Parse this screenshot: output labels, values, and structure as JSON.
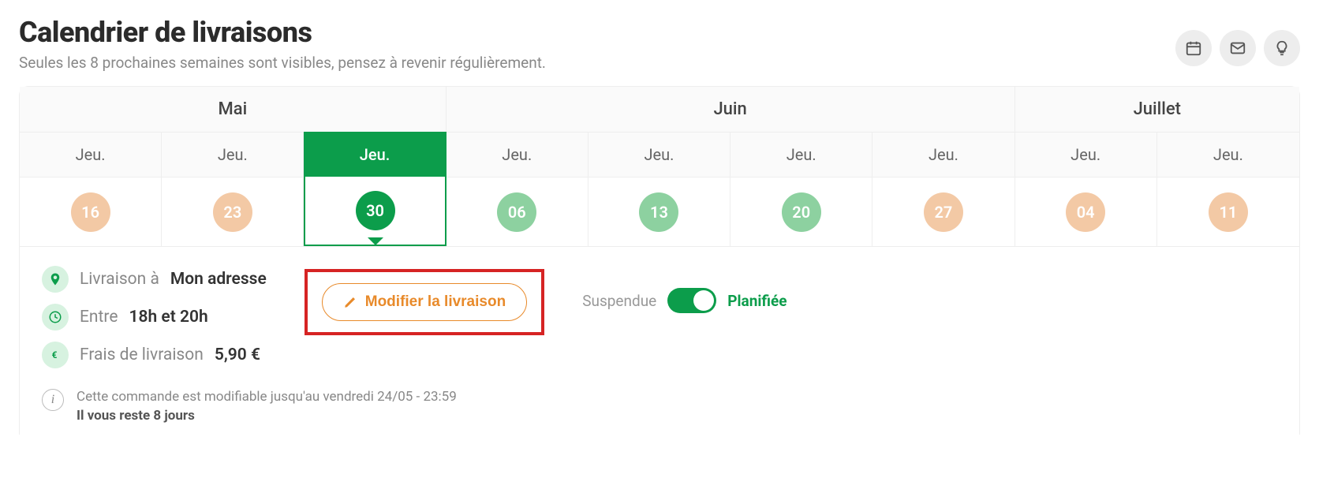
{
  "header": {
    "title": "Calendrier de livraisons",
    "subtitle": "Seules les 8 prochaines semaines sont visibles, pensez à revenir régulièrement."
  },
  "calendar": {
    "months": [
      {
        "label": "Mai",
        "span": 3
      },
      {
        "label": "Juin",
        "span": 4
      },
      {
        "label": "Juillet",
        "span": 2
      }
    ],
    "days": [
      {
        "day_label": "Jeu.",
        "date": "16",
        "color": "peach",
        "selected": false
      },
      {
        "day_label": "Jeu.",
        "date": "23",
        "color": "peach",
        "selected": false
      },
      {
        "day_label": "Jeu.",
        "date": "30",
        "color": "dark-green",
        "selected": true
      },
      {
        "day_label": "Jeu.",
        "date": "06",
        "color": "light-green",
        "selected": false
      },
      {
        "day_label": "Jeu.",
        "date": "13",
        "color": "light-green",
        "selected": false
      },
      {
        "day_label": "Jeu.",
        "date": "20",
        "color": "light-green",
        "selected": false
      },
      {
        "day_label": "Jeu.",
        "date": "27",
        "color": "peach",
        "selected": false
      },
      {
        "day_label": "Jeu.",
        "date": "04",
        "color": "peach",
        "selected": false
      },
      {
        "day_label": "Jeu.",
        "date": "11",
        "color": "peach",
        "selected": false
      }
    ]
  },
  "delivery": {
    "location_label": "Livraison à",
    "location_value": "Mon adresse",
    "time_label": "Entre",
    "time_value": "18h et 20h",
    "fee_label": "Frais de livraison",
    "fee_value": "5,90 €",
    "modify_label": "Modifier la livraison",
    "toggle_off": "Suspendue",
    "toggle_on": "Planifiée"
  },
  "footer": {
    "deadline_text": "Cette commande est modifiable jusqu'au vendredi 24/05 - 23:59",
    "remaining_text": "Il vous reste 8 jours"
  }
}
